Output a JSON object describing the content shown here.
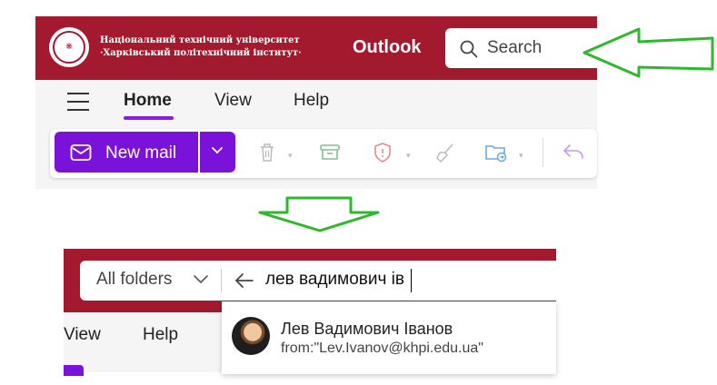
{
  "top": {
    "university_line1": "Національний технічний університет",
    "university_line2": "·Харківський політехнічний інститут·",
    "logo_icon": "university-seal-icon",
    "app_title": "Outlook",
    "search_placeholder": "Search",
    "tabs": [
      {
        "label": "Home",
        "active": true
      },
      {
        "label": "View",
        "active": false
      },
      {
        "label": "Help",
        "active": false
      }
    ],
    "new_mail_label": "New mail",
    "toolbar_icons": [
      "delete-icon",
      "archive-icon",
      "report-icon",
      "sweep-icon",
      "move-to-folder-icon",
      "reply-icon"
    ]
  },
  "bottom": {
    "folder_scope": "All folders",
    "search_query": "лев вадимович ів",
    "tabs": [
      {
        "label": "View"
      },
      {
        "label": "Help"
      }
    ],
    "suggestion": {
      "name": "Лев Вадимович Іванов",
      "email": "from:\"Lev.Ivanov@khpi.edu.ua\""
    }
  },
  "colors": {
    "header_red": "#a3192e",
    "accent_purple": "#7b12d9",
    "arrow_green": "#2db82d"
  }
}
